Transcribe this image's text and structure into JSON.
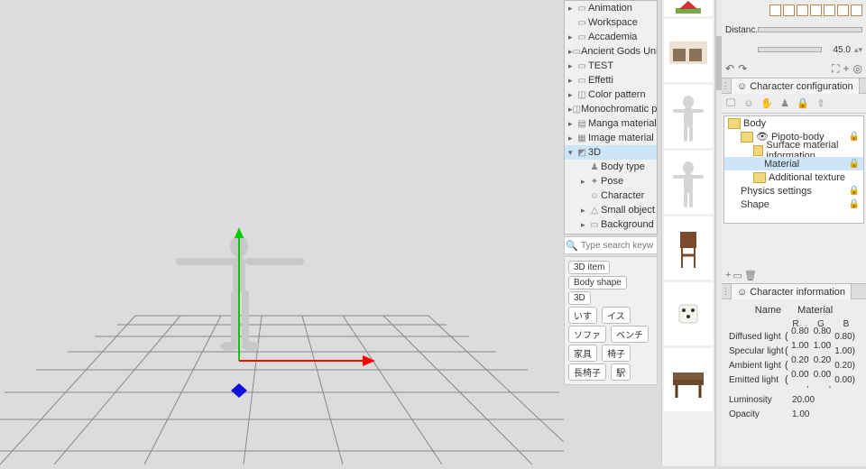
{
  "tree": [
    "Animation",
    "Workspace",
    "Accademia",
    "Ancient Gods Uni...",
    "TEST",
    "Effetti",
    "Color pattern",
    "Monochromatic pa...",
    "Manga material",
    "Image material",
    "3D",
    "Body type",
    "Pose",
    "Character",
    "Small object",
    "Background"
  ],
  "tree_selected": 10,
  "search_placeholder": "Type search keywords",
  "tags": [
    "3D item",
    "Body shape",
    "3D",
    "いす",
    "イス",
    "ソファ",
    "ベンチ",
    "家具",
    "椅子",
    "長椅子",
    "駅"
  ],
  "distance": {
    "label": "Distanc...",
    "value": "45.0"
  },
  "tab_config": "Character configuration",
  "body_tree": {
    "root": "Body",
    "child": "Pipoto-body",
    "surface": "Surface material information",
    "material": "Material",
    "texture": "Additional texture",
    "physics": "Physics settings",
    "shape": "Shape"
  },
  "tab_info": "Character information",
  "mat_header": {
    "name": "Name",
    "material": "Material",
    "r": "R",
    "g": "G",
    "b": "B"
  },
  "mat_rows": [
    {
      "label": "Diffused light",
      "paren": "(",
      "r": "0.80 ,",
      "g": "0.80 ,",
      "b": "0.80)"
    },
    {
      "label": "Specular light",
      "paren": "(",
      "r": "1.00 ,",
      "g": "1.00 ,",
      "b": "1.00)"
    },
    {
      "label": "Ambient light",
      "paren": "(",
      "r": "0.20 ,",
      "g": "0.20 ,",
      "b": "0.20)"
    },
    {
      "label": "Emitted light",
      "paren": "(",
      "r": "0.00 ,",
      "g": "0.00 ,",
      "b": "0.00)"
    }
  ],
  "luminosity": {
    "label": "Luminosity",
    "value": "20.00"
  },
  "opacity": {
    "label": "Opacity",
    "value": "1.00"
  }
}
